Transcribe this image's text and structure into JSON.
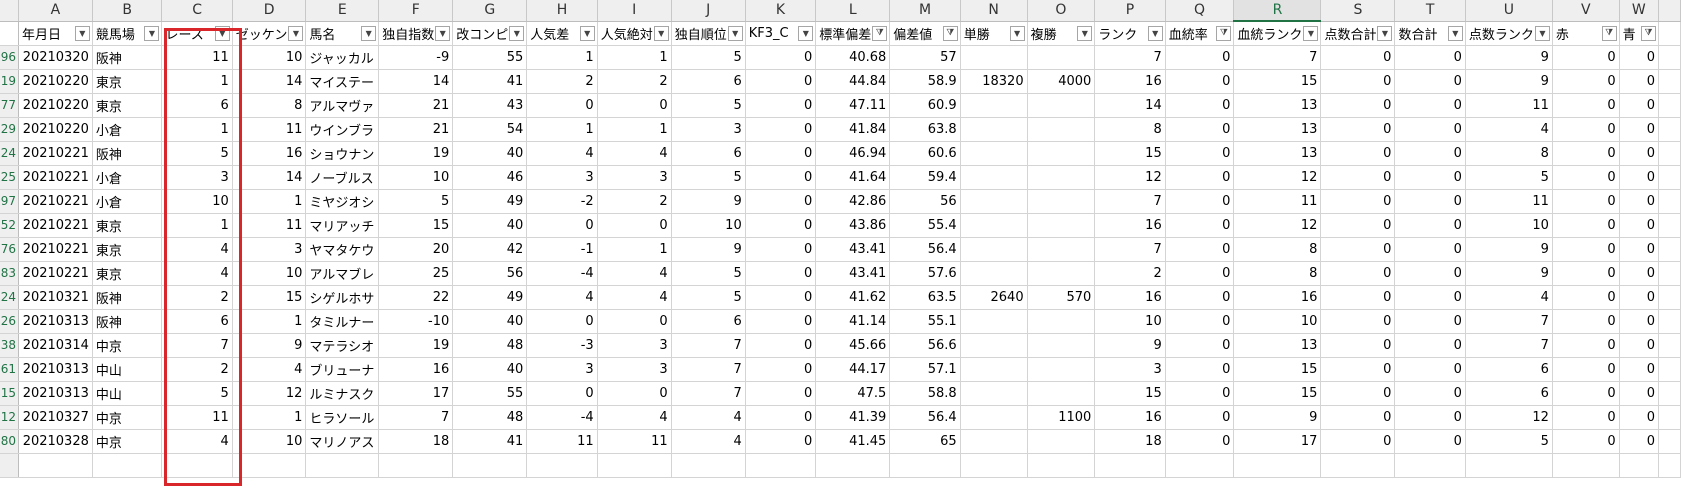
{
  "columns": [
    "A",
    "B",
    "C",
    "D",
    "E",
    "F",
    "G",
    "H",
    "I",
    "J",
    "K",
    "L",
    "M",
    "N",
    "O",
    "P",
    "Q",
    "R",
    "S",
    "T",
    "U",
    "V",
    "W"
  ],
  "selected_column": "R",
  "headers": [
    {
      "label": "年月日",
      "filter": "dropdown"
    },
    {
      "label": "競馬場",
      "filter": "dropdown"
    },
    {
      "label": "レース",
      "filter": "dropdown"
    },
    {
      "label": "ゼッケン",
      "filter": "dropdown"
    },
    {
      "label": "馬名",
      "filter": "dropdown"
    },
    {
      "label": "独自指数",
      "filter": "dropdown"
    },
    {
      "label": "改コンピ",
      "filter": "dropdown"
    },
    {
      "label": "人気差",
      "filter": "dropdown"
    },
    {
      "label": "人気絶対",
      "filter": "dropdown"
    },
    {
      "label": "独自順位",
      "filter": "dropdown"
    },
    {
      "label": "KF3_C",
      "filter": "dropdown"
    },
    {
      "label": "標準偏差",
      "filter": "active"
    },
    {
      "label": "偏差値",
      "filter": "active"
    },
    {
      "label": "単勝",
      "filter": "dropdown"
    },
    {
      "label": "複勝",
      "filter": "dropdown"
    },
    {
      "label": "ランク",
      "filter": "dropdown"
    },
    {
      "label": "血統率",
      "filter": "active"
    },
    {
      "label": "血統ランク",
      "filter": "dropdown"
    },
    {
      "label": "点数合計",
      "filter": "dropdown"
    },
    {
      "label": "数合計",
      "filter": "dropdown"
    },
    {
      "label": "点数ランク",
      "filter": "dropdown"
    },
    {
      "label": "赤",
      "filter": "active"
    },
    {
      "label": "青",
      "filter": "active"
    }
  ],
  "rows": [
    {
      "rownum": "96",
      "cells": [
        "20210320",
        "阪神",
        "11",
        "10",
        "ジャッカル",
        "-9",
        "55",
        "1",
        "1",
        "5",
        "0",
        "40.68",
        "57",
        "",
        "",
        "7",
        "0",
        "7",
        "0",
        "0",
        "9",
        "0",
        "0"
      ]
    },
    {
      "rownum": "19",
      "cells": [
        "20210220",
        "東京",
        "1",
        "14",
        "マイステー",
        "14",
        "41",
        "2",
        "2",
        "6",
        "0",
        "44.84",
        "58.9",
        "18320",
        "4000",
        "16",
        "0",
        "15",
        "0",
        "0",
        "9",
        "0",
        "0"
      ]
    },
    {
      "rownum": "77",
      "cells": [
        "20210220",
        "東京",
        "6",
        "8",
        "アルマヴァ",
        "21",
        "43",
        "0",
        "0",
        "5",
        "0",
        "47.11",
        "60.9",
        "",
        "",
        "14",
        "0",
        "13",
        "0",
        "0",
        "11",
        "0",
        "0"
      ]
    },
    {
      "rownum": "29",
      "cells": [
        "20210220",
        "小倉",
        "1",
        "11",
        "ウインブラ",
        "21",
        "54",
        "1",
        "1",
        "3",
        "0",
        "41.84",
        "63.8",
        "",
        "",
        "8",
        "0",
        "13",
        "0",
        "0",
        "4",
        "0",
        "0"
      ]
    },
    {
      "rownum": "24",
      "cells": [
        "20210221",
        "阪神",
        "5",
        "16",
        "ショウナン",
        "19",
        "40",
        "4",
        "4",
        "6",
        "0",
        "46.94",
        "60.6",
        "",
        "",
        "15",
        "0",
        "13",
        "0",
        "0",
        "8",
        "0",
        "0"
      ]
    },
    {
      "rownum": "25",
      "cells": [
        "20210221",
        "小倉",
        "3",
        "14",
        "ノーブルス",
        "10",
        "46",
        "3",
        "3",
        "5",
        "0",
        "41.64",
        "59.4",
        "",
        "",
        "12",
        "0",
        "12",
        "0",
        "0",
        "5",
        "0",
        "0"
      ]
    },
    {
      "rownum": "97",
      "cells": [
        "20210221",
        "小倉",
        "10",
        "1",
        "ミヤジオシ",
        "5",
        "49",
        "-2",
        "2",
        "9",
        "0",
        "42.86",
        "56",
        "",
        "",
        "7",
        "0",
        "11",
        "0",
        "0",
        "11",
        "0",
        "0"
      ]
    },
    {
      "rownum": "52",
      "cells": [
        "20210221",
        "東京",
        "1",
        "11",
        "マリアッチ",
        "15",
        "40",
        "0",
        "0",
        "10",
        "0",
        "43.86",
        "55.4",
        "",
        "",
        "16",
        "0",
        "12",
        "0",
        "0",
        "10",
        "0",
        "0"
      ]
    },
    {
      "rownum": "76",
      "cells": [
        "20210221",
        "東京",
        "4",
        "3",
        "ヤマタケウ",
        "20",
        "42",
        "-1",
        "1",
        "9",
        "0",
        "43.41",
        "56.4",
        "",
        "",
        "7",
        "0",
        "8",
        "0",
        "0",
        "9",
        "0",
        "0"
      ]
    },
    {
      "rownum": "83",
      "cells": [
        "20210221",
        "東京",
        "4",
        "10",
        "アルマブレ",
        "25",
        "56",
        "-4",
        "4",
        "5",
        "0",
        "43.41",
        "57.6",
        "",
        "",
        "2",
        "0",
        "8",
        "0",
        "0",
        "9",
        "0",
        "0"
      ]
    },
    {
      "rownum": "24",
      "cells": [
        "20210321",
        "阪神",
        "2",
        "15",
        "シゲルホサ",
        "22",
        "49",
        "4",
        "4",
        "5",
        "0",
        "41.62",
        "63.5",
        "2640",
        "570",
        "16",
        "0",
        "16",
        "0",
        "0",
        "4",
        "0",
        "0"
      ]
    },
    {
      "rownum": "26",
      "cells": [
        "20210313",
        "阪神",
        "6",
        "1",
        "タミルナー",
        "-10",
        "40",
        "0",
        "0",
        "6",
        "0",
        "41.14",
        "55.1",
        "",
        "",
        "10",
        "0",
        "10",
        "0",
        "0",
        "7",
        "0",
        "0"
      ]
    },
    {
      "rownum": "38",
      "cells": [
        "20210314",
        "中京",
        "7",
        "9",
        "マテラシオ",
        "19",
        "48",
        "-3",
        "3",
        "7",
        "0",
        "45.66",
        "56.6",
        "",
        "",
        "9",
        "0",
        "13",
        "0",
        "0",
        "7",
        "0",
        "0"
      ]
    },
    {
      "rownum": "61",
      "cells": [
        "20210313",
        "中山",
        "2",
        "4",
        "ブリューナ",
        "16",
        "40",
        "3",
        "3",
        "7",
        "0",
        "44.17",
        "57.1",
        "",
        "",
        "3",
        "0",
        "15",
        "0",
        "0",
        "6",
        "0",
        "0"
      ]
    },
    {
      "rownum": "15",
      "cells": [
        "20210313",
        "中山",
        "5",
        "12",
        "ルミナスク",
        "17",
        "55",
        "0",
        "0",
        "7",
        "0",
        "47.5",
        "58.8",
        "",
        "",
        "15",
        "0",
        "15",
        "0",
        "0",
        "6",
        "0",
        "0"
      ]
    },
    {
      "rownum": "12",
      "cells": [
        "20210327",
        "中京",
        "11",
        "1",
        "ヒラソール",
        "7",
        "48",
        "-4",
        "4",
        "4",
        "0",
        "41.39",
        "56.4",
        "",
        "1100",
        "16",
        "0",
        "9",
        "0",
        "0",
        "12",
        "0",
        "0"
      ]
    },
    {
      "rownum": "80",
      "cells": [
        "20210328",
        "中京",
        "4",
        "10",
        "マリノアス",
        "18",
        "41",
        "11",
        "11",
        "4",
        "0",
        "41.45",
        "65",
        "",
        "",
        "18",
        "0",
        "17",
        "0",
        "0",
        "5",
        "0",
        "0"
      ]
    }
  ],
  "highlight_color": "#d9262b"
}
